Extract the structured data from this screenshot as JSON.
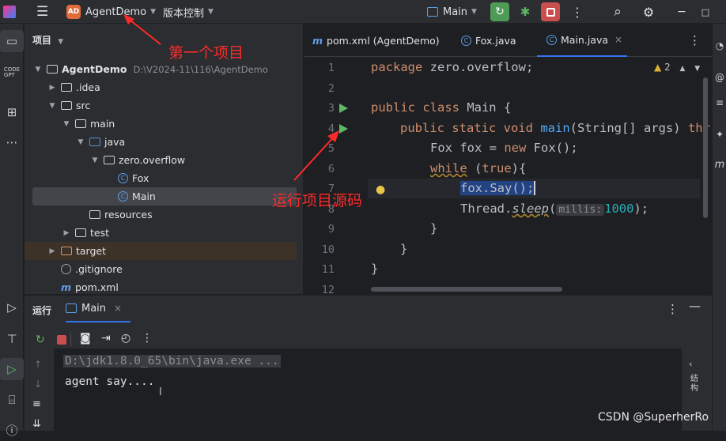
{
  "topbar": {
    "project_badge": "AD",
    "project_name": "AgentDemo",
    "vcs_label": "版本控制",
    "run_config": "Main"
  },
  "project_panel": {
    "title": "项目",
    "root_name": "AgentDemo",
    "root_path": "D:\\V2024-11\\116\\AgentDemo",
    "items": [
      {
        "label": ".idea"
      },
      {
        "label": "src"
      },
      {
        "label": "main"
      },
      {
        "label": "java"
      },
      {
        "label": "zero.overflow"
      },
      {
        "label": "Fox"
      },
      {
        "label": "Main"
      },
      {
        "label": "resources"
      },
      {
        "label": "test"
      },
      {
        "label": "target"
      },
      {
        "label": ".gitignore"
      },
      {
        "label": "pom.xml"
      }
    ]
  },
  "editor": {
    "tabs": [
      {
        "label": "pom.xml (AgentDemo)"
      },
      {
        "label": "Fox.java"
      },
      {
        "label": "Main.java"
      }
    ],
    "warning_count": "2",
    "line_numbers": [
      "1",
      "2",
      "3",
      "4",
      "5",
      "6",
      "7",
      "8",
      "9",
      "10",
      "11",
      "12"
    ],
    "code": {
      "l1_kw": "package",
      "l1_rest": " zero.overflow;",
      "l3_kw": "public class",
      "l3_rest": " Main {",
      "l4_kw": "public static void",
      "l4_fn": "main",
      "l4_rest": "(String[] args) ",
      "l4_tail": "thr",
      "l5_a": "Fox fox = ",
      "l5_kw": "new",
      "l5_b": " Fox();",
      "l6_kw": "while",
      "l6_a": " (",
      "l6_kw2": "true",
      "l6_b": "){",
      "l7_sel": "fox.Say();",
      "l8_a": "Thread.",
      "l8_fn": "sleep",
      "l8_b": "(",
      "l8_hint": "millis:",
      "l8_num": "1000",
      "l8_c": ");",
      "l9": "}",
      "l10": "}",
      "l11": "}"
    }
  },
  "run_panel": {
    "title": "运行",
    "tab": "Main",
    "console_lines": [
      "D:\\jdk1.8.0_65\\bin\\java.exe ...",
      "agent say...."
    ],
    "side_label": "结构"
  },
  "annotations": {
    "first_project": "第一个项目",
    "run_source": "运行项目源码"
  },
  "watermark": "CSDN @SuperherRo",
  "colors": {
    "accent": "#3574f0",
    "run_green": "#5fb865",
    "stop_red": "#db5c5c",
    "annotation_red": "#ff2a2a"
  }
}
